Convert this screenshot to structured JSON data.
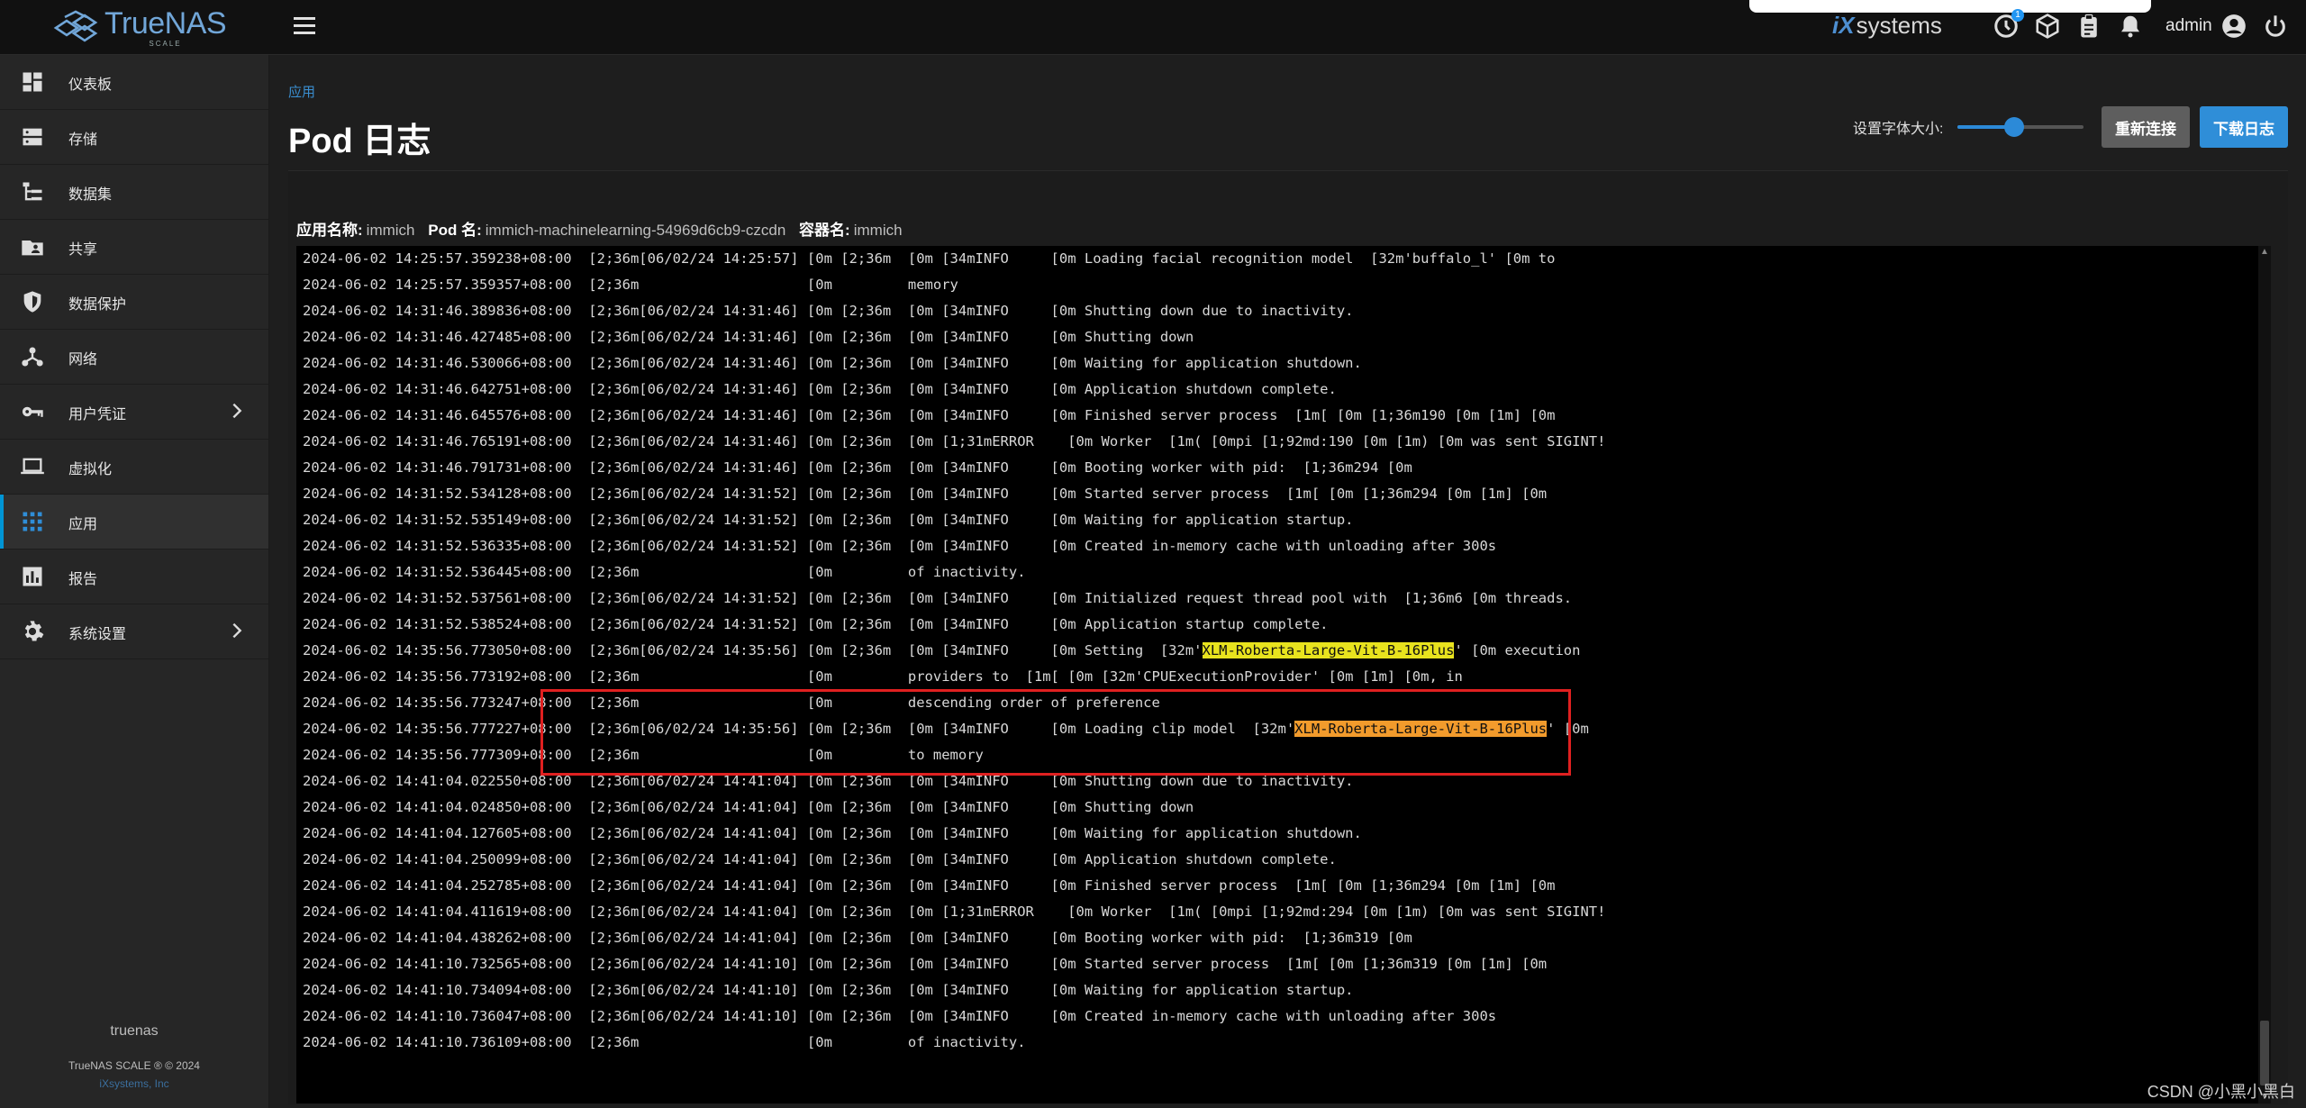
{
  "app": {
    "logo_name": "TrueNAS",
    "logo_sub": "SCALE",
    "ix_prefix": "iX",
    "ix_suffix": "systems",
    "user": "admin",
    "notification_count": "1"
  },
  "sidebar": {
    "items": [
      {
        "label": "仪表板",
        "icon": "dashboard-icon"
      },
      {
        "label": "存储",
        "icon": "storage-icon"
      },
      {
        "label": "数据集",
        "icon": "datasets-icon"
      },
      {
        "label": "共享",
        "icon": "shares-icon"
      },
      {
        "label": "数据保护",
        "icon": "shield-icon"
      },
      {
        "label": "网络",
        "icon": "network-icon"
      },
      {
        "label": "用户凭证",
        "icon": "key-icon",
        "has_arrow": true
      },
      {
        "label": "虚拟化",
        "icon": "laptop-icon"
      },
      {
        "label": "应用",
        "icon": "apps-grid-icon",
        "active": true
      },
      {
        "label": "报告",
        "icon": "reports-icon"
      },
      {
        "label": "系统设置",
        "icon": "gear-icon",
        "has_arrow": true
      }
    ],
    "hostname": "truenas",
    "version": "TrueNAS SCALE ® © 2024",
    "company": "iXsystems, Inc"
  },
  "page": {
    "breadcrumb": "应用",
    "title": "Pod 日志",
    "font_size_label": "设置字体大小:",
    "font_size_value": 0.45,
    "reconnect_label": "重新连接",
    "download_label": "下载日志"
  },
  "meta": {
    "app_name_label": "应用名称:",
    "app_name": "immich",
    "pod_label": "Pod 名:",
    "pod_name": "immich-machinelearning-54969d6cb9-czcdn",
    "container_label": "容器名:",
    "container_name": "immich"
  },
  "colors": {
    "accent": "#2f8ed8",
    "highlight_yellow": "#e8e31e",
    "highlight_orange": "#f29b2c",
    "annotation_red": "#e02020"
  },
  "log_lines": [
    {
      "ts": "2024-06-02 14:25:57.359238+08:00",
      "text": "  [2;36m[06/02/24 14:25:57] [0m [2;36m  [0m [34mINFO     [0m Loading facial recognition model  [32m'buffalo_l' [0m to"
    },
    {
      "ts": "2024-06-02 14:25:57.359357+08:00",
      "text": "  [2;36m                    [0m         memory"
    },
    {
      "ts": "2024-06-02 14:31:46.389836+08:00",
      "text": "  [2;36m[06/02/24 14:31:46] [0m [2;36m  [0m [34mINFO     [0m Shutting down due to inactivity."
    },
    {
      "ts": "2024-06-02 14:31:46.427485+08:00",
      "text": "  [2;36m[06/02/24 14:31:46] [0m [2;36m  [0m [34mINFO     [0m Shutting down"
    },
    {
      "ts": "2024-06-02 14:31:46.530066+08:00",
      "text": "  [2;36m[06/02/24 14:31:46] [0m [2;36m  [0m [34mINFO     [0m Waiting for application shutdown."
    },
    {
      "ts": "2024-06-02 14:31:46.642751+08:00",
      "text": "  [2;36m[06/02/24 14:31:46] [0m [2;36m  [0m [34mINFO     [0m Application shutdown complete."
    },
    {
      "ts": "2024-06-02 14:31:46.645576+08:00",
      "text": "  [2;36m[06/02/24 14:31:46] [0m [2;36m  [0m [34mINFO     [0m Finished server process  [1m[ [0m [1;36m190 [0m [1m] [0m"
    },
    {
      "ts": "2024-06-02 14:31:46.765191+08:00",
      "text": "  [2;36m[06/02/24 14:31:46] [0m [2;36m  [0m [1;31mERROR    [0m Worker  [1m( [0mpi [1;92md:190 [0m [1m) [0m was sent SIGINT!"
    },
    {
      "ts": "2024-06-02 14:31:46.791731+08:00",
      "text": "  [2;36m[06/02/24 14:31:46] [0m [2;36m  [0m [34mINFO     [0m Booting worker with pid:  [1;36m294 [0m"
    },
    {
      "ts": "2024-06-02 14:31:52.534128+08:00",
      "text": "  [2;36m[06/02/24 14:31:52] [0m [2;36m  [0m [34mINFO     [0m Started server process  [1m[ [0m [1;36m294 [0m [1m] [0m"
    },
    {
      "ts": "2024-06-02 14:31:52.535149+08:00",
      "text": "  [2;36m[06/02/24 14:31:52] [0m [2;36m  [0m [34mINFO     [0m Waiting for application startup."
    },
    {
      "ts": "2024-06-02 14:31:52.536335+08:00",
      "text": "  [2;36m[06/02/24 14:31:52] [0m [2;36m  [0m [34mINFO     [0m Created in-memory cache with unloading after 300s"
    },
    {
      "ts": "2024-06-02 14:31:52.536445+08:00",
      "text": "  [2;36m                    [0m         of inactivity."
    },
    {
      "ts": "2024-06-02 14:31:52.537561+08:00",
      "text": "  [2;36m[06/02/24 14:31:52] [0m [2;36m  [0m [34mINFO     [0m Initialized request thread pool with  [1;36m6 [0m threads."
    },
    {
      "ts": "2024-06-02 14:31:52.538524+08:00",
      "text": "  [2;36m[06/02/24 14:31:52] [0m [2;36m  [0m [34mINFO     [0m Application startup complete."
    },
    {
      "ts": "2024-06-02 14:35:56.773050+08:00",
      "pre": "  [2;36m[06/02/24 14:35:56] [0m [2;36m  [0m [34mINFO     [0m Setting  [32m'",
      "hl": "XLM-Roberta-Large-Vit-B-16Plus",
      "hl_color": "yellow",
      "post": "' [0m execution"
    },
    {
      "ts": "2024-06-02 14:35:56.773192+08:00",
      "text": "  [2;36m                    [0m         providers to  [1m[ [0m [32m'CPUExecutionProvider' [0m [1m] [0m, in"
    },
    {
      "ts": "2024-06-02 14:35:56.773247+08:00",
      "text": "  [2;36m                    [0m         descending order of preference"
    },
    {
      "ts": "2024-06-02 14:35:56.777227+08:00",
      "pre": "  [2;36m[06/02/24 14:35:56] [0m [2;36m  [0m [34mINFO     [0m Loading clip model  [32m'",
      "hl": "XLM-Roberta-Large-Vit-B-16Plus",
      "hl_color": "orange",
      "post": "' [0m"
    },
    {
      "ts": "2024-06-02 14:35:56.777309+08:00",
      "text": "  [2;36m                    [0m         to memory"
    },
    {
      "ts": "2024-06-02 14:41:04.022550+08:00",
      "text": "  [2;36m[06/02/24 14:41:04] [0m [2;36m  [0m [34mINFO     [0m Shutting down due to inactivity."
    },
    {
      "ts": "2024-06-02 14:41:04.024850+08:00",
      "text": "  [2;36m[06/02/24 14:41:04] [0m [2;36m  [0m [34mINFO     [0m Shutting down"
    },
    {
      "ts": "2024-06-02 14:41:04.127605+08:00",
      "text": "  [2;36m[06/02/24 14:41:04] [0m [2;36m  [0m [34mINFO     [0m Waiting for application shutdown."
    },
    {
      "ts": "2024-06-02 14:41:04.250099+08:00",
      "text": "  [2;36m[06/02/24 14:41:04] [0m [2;36m  [0m [34mINFO     [0m Application shutdown complete."
    },
    {
      "ts": "2024-06-02 14:41:04.252785+08:00",
      "text": "  [2;36m[06/02/24 14:41:04] [0m [2;36m  [0m [34mINFO     [0m Finished server process  [1m[ [0m [1;36m294 [0m [1m] [0m"
    },
    {
      "ts": "2024-06-02 14:41:04.411619+08:00",
      "text": "  [2;36m[06/02/24 14:41:04] [0m [2;36m  [0m [1;31mERROR    [0m Worker  [1m( [0mpi [1;92md:294 [0m [1m) [0m was sent SIGINT!"
    },
    {
      "ts": "2024-06-02 14:41:04.438262+08:00",
      "text": "  [2;36m[06/02/24 14:41:04] [0m [2;36m  [0m [34mINFO     [0m Booting worker with pid:  [1;36m319 [0m"
    },
    {
      "ts": "2024-06-02 14:41:10.732565+08:00",
      "text": "  [2;36m[06/02/24 14:41:10] [0m [2;36m  [0m [34mINFO     [0m Started server process  [1m[ [0m [1;36m319 [0m [1m] [0m"
    },
    {
      "ts": "2024-06-02 14:41:10.734094+08:00",
      "text": "  [2;36m[06/02/24 14:41:10] [0m [2;36m  [0m [34mINFO     [0m Waiting for application startup."
    },
    {
      "ts": "2024-06-02 14:41:10.736047+08:00",
      "text": "  [2;36m[06/02/24 14:41:10] [0m [2;36m  [0m [34mINFO     [0m Created in-memory cache with unloading after 300s"
    },
    {
      "ts": "2024-06-02 14:41:10.736109+08:00",
      "text": "  [2;36m                    [0m         of inactivity."
    }
  ],
  "watermark": "CSDN @小黑小黑白"
}
